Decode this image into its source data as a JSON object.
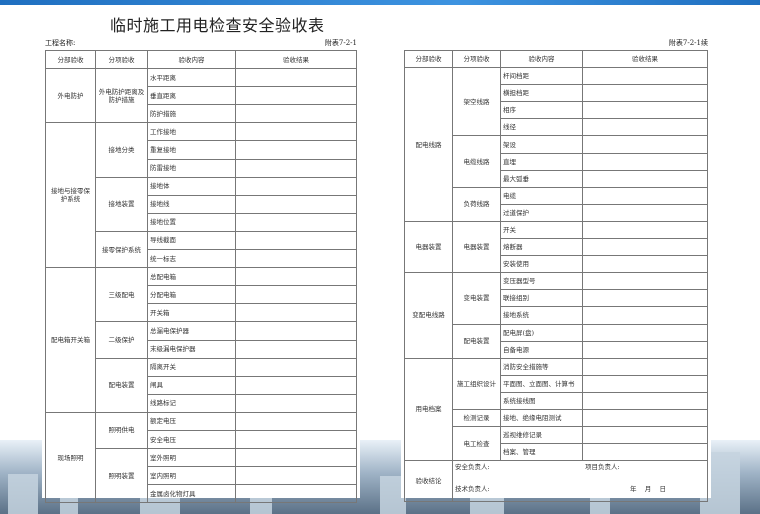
{
  "title": "临时施工用电检查安全验收表",
  "left_sheet": {
    "project_label": "工程名称:",
    "code": "附表7-2-1",
    "headers": [
      "分部验收",
      "分项验收",
      "验收内容",
      "验收结果"
    ],
    "rows": [
      [
        "外电防护",
        "外电防护距离及防护措施",
        "水平距离"
      ],
      [
        "",
        "",
        "垂直距离"
      ],
      [
        "",
        "",
        "防护措施"
      ],
      [
        "接地与接零保护系统",
        "接地分类",
        "工作接地"
      ],
      [
        "",
        "",
        "重复接地"
      ],
      [
        "",
        "",
        "防雷接地"
      ],
      [
        "",
        "接地装置",
        "接地体"
      ],
      [
        "",
        "",
        "接地线"
      ],
      [
        "",
        "",
        "接地位置"
      ],
      [
        "",
        "接零保护系统",
        "导线截面"
      ],
      [
        "",
        "",
        "统一标志"
      ],
      [
        "配电箱开关箱",
        "三级配电",
        "总配电箱"
      ],
      [
        "",
        "",
        "分配电箱"
      ],
      [
        "",
        "",
        "开关箱"
      ],
      [
        "",
        "二级保护",
        "总漏电保护器"
      ],
      [
        "",
        "",
        "末级漏电保护器"
      ],
      [
        "",
        "配电装置",
        "隔离开关"
      ],
      [
        "",
        "",
        "闸具"
      ],
      [
        "",
        "",
        "线路标记"
      ],
      [
        "现场照明",
        "照明供电",
        "额定电压"
      ],
      [
        "",
        "",
        "安全电压"
      ],
      [
        "",
        "照明装置",
        "室外照明"
      ],
      [
        "",
        "",
        "室内照明"
      ],
      [
        "",
        "",
        "金属卤化物灯具"
      ]
    ]
  },
  "right_sheet": {
    "code": "附表7-2-1续",
    "headers": [
      "分部验收",
      "分项验收",
      "验收内容",
      "验收结果"
    ],
    "rows": [
      [
        "配电线路",
        "架空线路",
        "杆间档距"
      ],
      [
        "",
        "",
        "横担档距"
      ],
      [
        "",
        "",
        "相序"
      ],
      [
        "",
        "",
        "线径"
      ],
      [
        "",
        "电缆线路",
        "架设"
      ],
      [
        "",
        "",
        "直埋"
      ],
      [
        "",
        "",
        "最大弧垂"
      ],
      [
        "",
        "负荷线路",
        "电缆"
      ],
      [
        "",
        "",
        "过道保护"
      ],
      [
        "电器装置",
        "电器装置",
        "开关"
      ],
      [
        "",
        "",
        "熔断器"
      ],
      [
        "",
        "",
        "安装使用"
      ],
      [
        "变配电线路",
        "变电装置",
        "变压器型号"
      ],
      [
        "",
        "",
        "联接组别"
      ],
      [
        "",
        "",
        "接地系统"
      ],
      [
        "",
        "配电装置",
        "配电屏(盘)"
      ],
      [
        "",
        "",
        "自备电源"
      ],
      [
        "用电档案",
        "施工组织设计",
        "消防安全措施等"
      ],
      [
        "",
        "",
        "平面图、立面图、计算书"
      ],
      [
        "",
        "",
        "系统接线图"
      ],
      [
        "",
        "检测记录",
        "接地、绝缘电阻测试"
      ],
      [
        "",
        "电工检查",
        "巡视维修记录"
      ],
      [
        "",
        "",
        "档案、管理"
      ]
    ],
    "signoff": {
      "label": "验收结论",
      "safety_officer": "安全负责人:",
      "project_manager": "项目负责人:",
      "tech_officer": "技术负责人:",
      "date": "年    月    日"
    }
  }
}
